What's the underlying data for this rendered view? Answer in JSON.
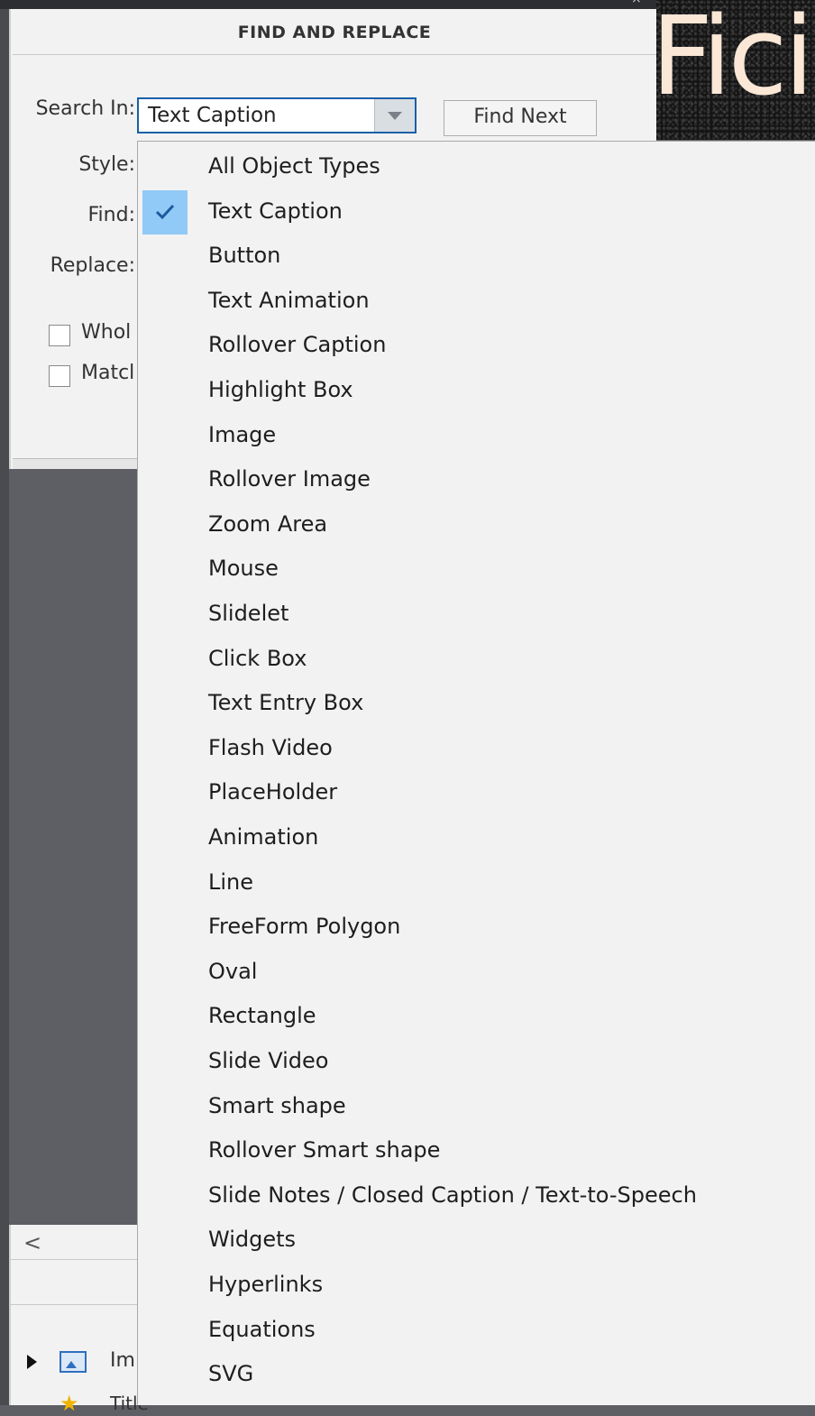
{
  "panel": {
    "title": "FIND AND REPLACE",
    "labels": {
      "search_in": "Search In:",
      "style": "Style:",
      "find": "Find:",
      "replace": "Replace:"
    },
    "search_in_value": "Text Caption",
    "find_next_label": "Find Next",
    "checkboxes": [
      {
        "label": "Whol",
        "checked": false
      },
      {
        "label": "Matcl",
        "checked": false
      }
    ]
  },
  "background": {
    "text": "Ficia"
  },
  "lower_panel": {
    "tree_item_label": "Im",
    "tree_item2_label": "Title"
  },
  "dropdown": {
    "selected": "Text Caption",
    "items": [
      "All Object Types",
      "Text Caption",
      "Button",
      "Text Animation",
      "Rollover Caption",
      "Highlight Box",
      "Image",
      "Rollover Image",
      "Zoom Area",
      "Mouse",
      "Slidelet",
      "Click Box",
      "Text Entry Box",
      "Flash Video",
      "PlaceHolder",
      "Animation",
      "Line",
      "FreeForm Polygon",
      "Oval",
      "Rectangle",
      "Slide Video",
      "Smart shape",
      "Rollover Smart shape",
      "Slide Notes / Closed Caption / Text-to-Speech",
      "Widgets",
      "Hyperlinks",
      "Equations",
      "SVG"
    ]
  },
  "colors": {
    "accent": "#1a5fa8",
    "selection": "#91c9f7",
    "check": "#1c5a9e"
  }
}
